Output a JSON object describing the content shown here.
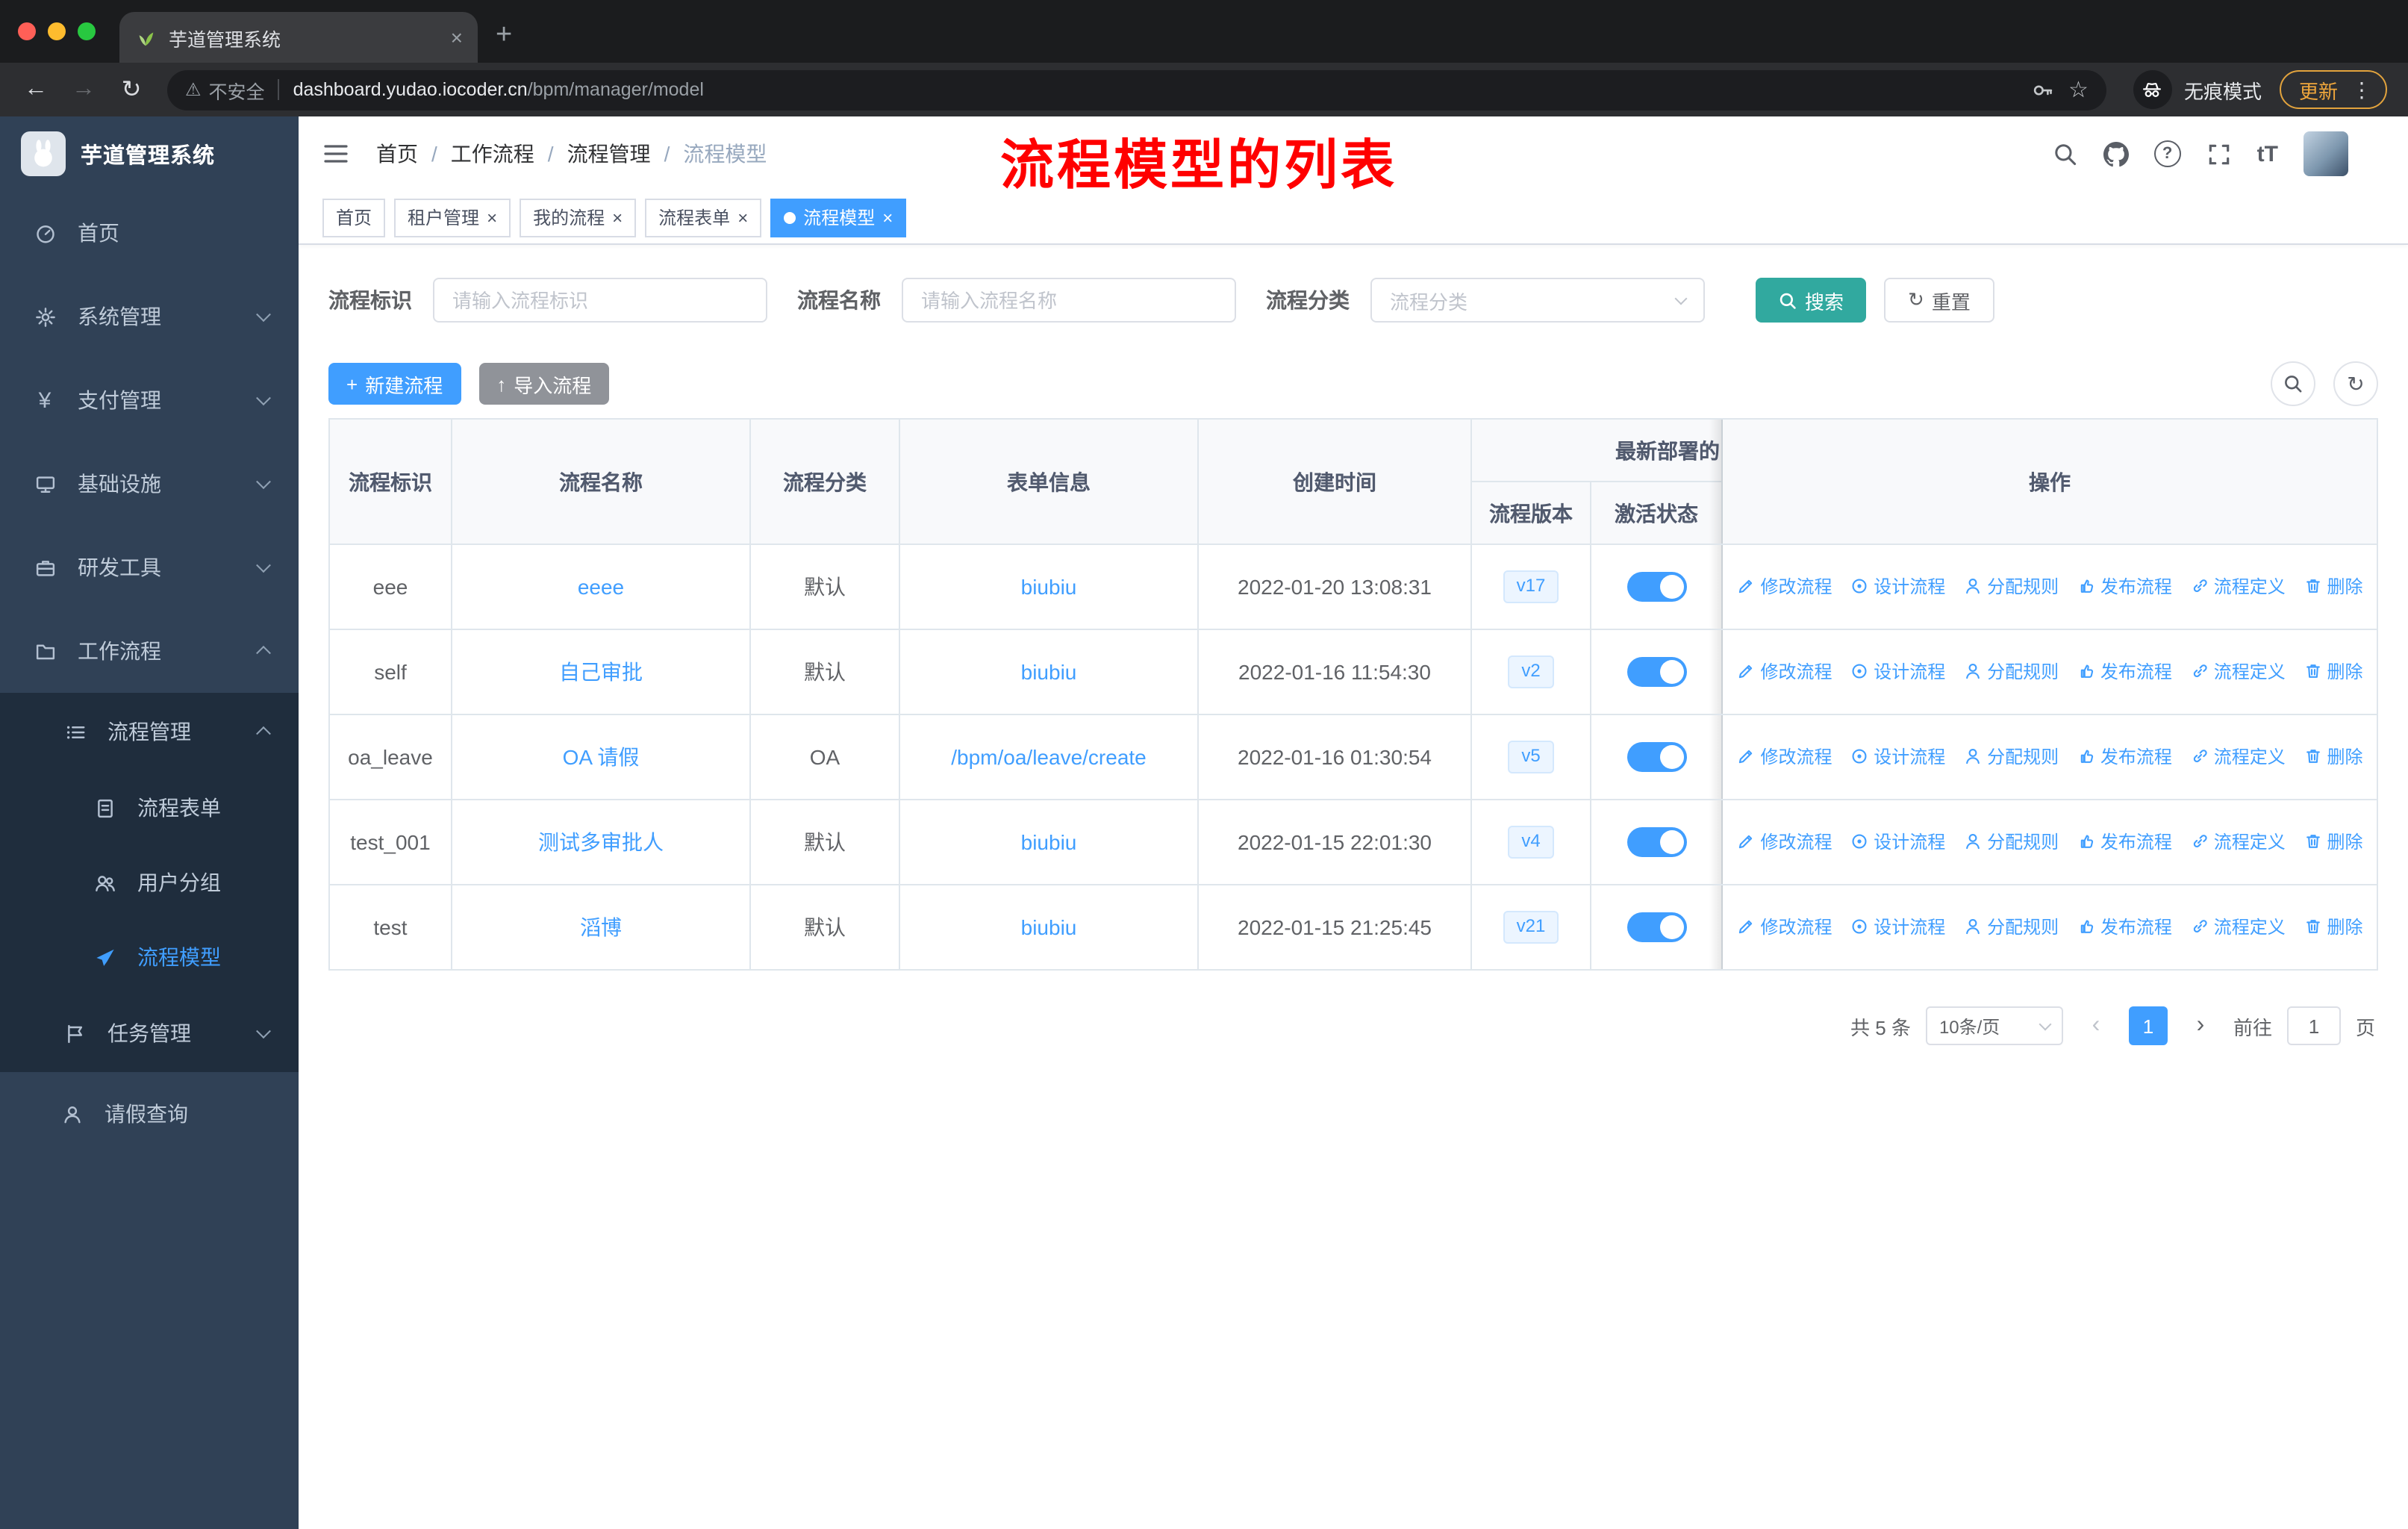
{
  "colors": {
    "primary": "#409EFF",
    "search_button_teal": "#31a99f",
    "annotation_red": "#FF0000",
    "sidebar_bg": "#304156",
    "sidebar_submenu_bg": "#1f2d3d",
    "import_button_gray": "#909399",
    "toggle_on": "#409EFF",
    "update_chip_orange": "#e2a33d",
    "version_badge_bg": "#ecf5ff"
  },
  "icons": {
    "back": "←",
    "forward": "→",
    "reload": "↻",
    "warning": "⚠",
    "star": "☆",
    "close": "×",
    "menu_dots": "⋮",
    "new_tab": "+",
    "plus": "+",
    "upload": "↑",
    "refresh": "↻",
    "question": "?",
    "font_size": "tT",
    "yen": "¥",
    "prev": "‹",
    "next": "›"
  },
  "browser": {
    "tab_title": "芋道管理系统",
    "security_label": "不安全",
    "url_host": "dashboard.yudao.iocoder.cn",
    "url_path": "/bpm/manager/model",
    "incognito_label": "无痕模式",
    "update_label": "更新"
  },
  "sidebar": {
    "logo_title": "芋道管理系统",
    "items": [
      {
        "label": "首页"
      },
      {
        "label": "系统管理"
      },
      {
        "label": "支付管理"
      },
      {
        "label": "基础设施"
      },
      {
        "label": "研发工具"
      },
      {
        "label": "工作流程"
      },
      {
        "label": "流程管理"
      },
      {
        "label": "流程表单"
      },
      {
        "label": "用户分组"
      },
      {
        "label": "流程模型"
      },
      {
        "label": "任务管理"
      },
      {
        "label": "请假查询"
      }
    ]
  },
  "header": {
    "breadcrumb": [
      "首页",
      "工作流程",
      "流程管理",
      "流程模型"
    ],
    "breadcrumb_separator": "/",
    "annotation": "流程模型的列表"
  },
  "tags": [
    {
      "label": "首页",
      "closable": false,
      "active": false
    },
    {
      "label": "租户管理",
      "closable": true,
      "active": false
    },
    {
      "label": "我的流程",
      "closable": true,
      "active": false
    },
    {
      "label": "流程表单",
      "closable": true,
      "active": false
    },
    {
      "label": "流程模型",
      "closable": true,
      "active": true
    }
  ],
  "filters": {
    "fields": [
      {
        "label": "流程标识",
        "placeholder": "请输入流程标识",
        "value": ""
      },
      {
        "label": "流程名称",
        "placeholder": "请输入流程名称",
        "value": ""
      },
      {
        "label": "流程分类",
        "placeholder": "流程分类",
        "value": ""
      }
    ],
    "search_label": "搜索",
    "reset_label": "重置"
  },
  "toolbar": {
    "create_label": "新建流程",
    "import_label": "导入流程"
  },
  "table": {
    "headers": {
      "id": "流程标识",
      "name": "流程名称",
      "category": "流程分类",
      "form": "表单信息",
      "created": "创建时间",
      "deploy_group": "最新部署的",
      "version": "流程版本",
      "active": "激活状态",
      "actions": "操作"
    },
    "action_labels": [
      "修改流程",
      "设计流程",
      "分配规则",
      "发布流程",
      "流程定义",
      "删除"
    ],
    "rows": [
      {
        "id": "eee",
        "name": "eeee",
        "category": "默认",
        "form": "biubiu",
        "created": "2022-01-20 13:08:31",
        "version": "v17",
        "active": true
      },
      {
        "id": "self",
        "name": "自己审批",
        "category": "默认",
        "form": "biubiu",
        "created": "2022-01-16 11:54:30",
        "version": "v2",
        "active": true
      },
      {
        "id": "oa_leave",
        "name": "OA 请假",
        "category": "OA",
        "form": "/bpm/oa/leave/create",
        "created": "2022-01-16 01:30:54",
        "version": "v5",
        "active": true
      },
      {
        "id": "test_001",
        "name": "测试多审批人",
        "category": "默认",
        "form": "biubiu",
        "created": "2022-01-15 22:01:30",
        "version": "v4",
        "active": true
      },
      {
        "id": "test",
        "name": "滔博",
        "category": "默认",
        "form": "biubiu",
        "created": "2022-01-15 21:25:45",
        "version": "v21",
        "active": true
      }
    ]
  },
  "pagination": {
    "total_text": "共 5 条",
    "page_size": "10条/页",
    "current_page": "1",
    "goto_label": "前往",
    "goto_value": "1",
    "page_suffix": "页"
  }
}
